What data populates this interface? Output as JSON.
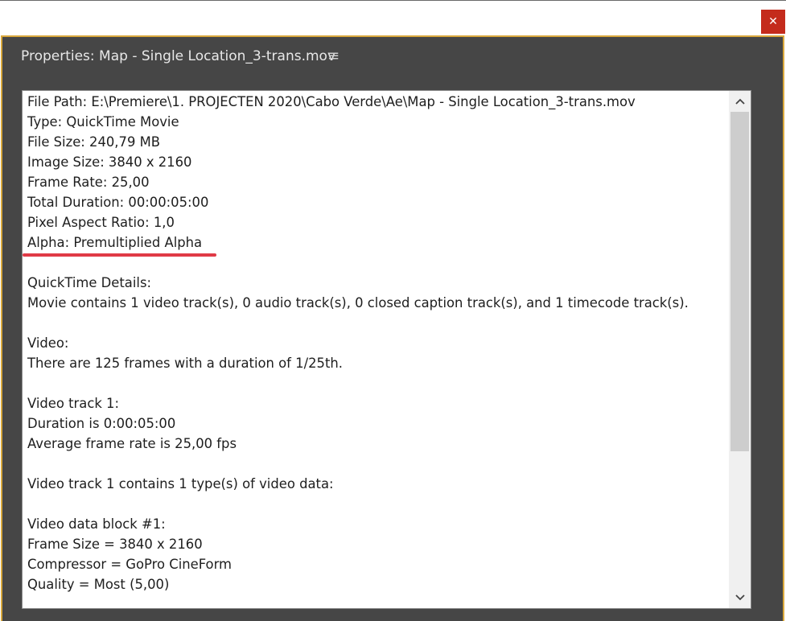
{
  "window": {
    "close_glyph": "✕"
  },
  "panel": {
    "title": "Properties: Map - Single Location_3-trans.mov",
    "menu_glyph": "≡"
  },
  "properties": {
    "lines": [
      "File Path: E:\\Premiere\\1. PROJECTEN 2020\\Cabo Verde\\Ae\\Map - Single Location_3-trans.mov",
      "Type: QuickTime Movie",
      "File Size: 240,79 MB",
      "Image Size: 3840 x 2160",
      "Frame Rate: 25,00",
      "Total Duration: 00:00:05:00",
      "Pixel Aspect Ratio: 1,0",
      "Alpha: Premultiplied Alpha",
      "",
      "QuickTime Details:",
      "Movie contains 1 video track(s), 0 audio track(s), 0 closed caption track(s), and 1 timecode track(s).",
      "",
      "Video:",
      "There are 125 frames with a duration of 1/25th.",
      "",
      "Video track 1:",
      "Duration is 0:00:05:00",
      "Average frame rate is 25,00 fps",
      "",
      "Video track 1 contains 1 type(s) of video data:",
      "",
      "Video data block #1:",
      "Frame Size = 3840 x 2160",
      "Compressor = GoPro CineForm",
      "Quality = Most (5,00)"
    ]
  },
  "scrollbar": {
    "up_glyph": "⌃",
    "down_glyph": "⌄"
  },
  "colors": {
    "panel_bg": "#464646",
    "panel_border": "#d9a83c",
    "close_button": "#c42b1c",
    "highlight_underline": "#e03a46"
  }
}
